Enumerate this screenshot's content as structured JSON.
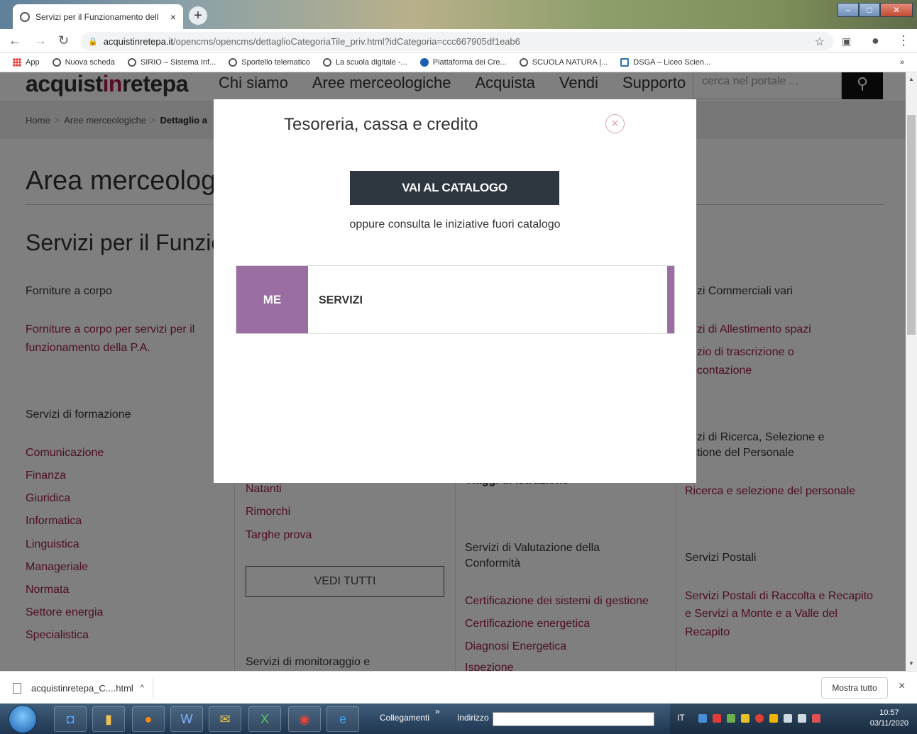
{
  "browser": {
    "tab_title": "Servizi per il Funzionamento dell",
    "tab_close": "×",
    "newtab": "+",
    "url_host": "acquistinretepa.it",
    "url_path": "/opencms/opencms/dettaglioCategoriaTile_priv.html?idCategoria=ccc667905df1eab6",
    "bookmarks": [
      "App",
      "Nuova scheda",
      "SIRIO – Sistema Inf...",
      "Sportello telematico",
      "La scuola digitale -...",
      "Piattaforma dei Cre...",
      "SCUOLA NATURA |...",
      "DSGA – Liceo Scien..."
    ],
    "bookmarks_more": "»"
  },
  "site": {
    "logo_a": "acquist",
    "logo_b": "in",
    "logo_c": "retepa",
    "nav": [
      "Chi siamo",
      "Aree merceologiche",
      "Acquista",
      "Vendi",
      "Supporto"
    ],
    "search_placeholder": "cerca nel portale ...",
    "breadcrumb": [
      "Home",
      "Aree merceologiche",
      "Dettaglio a"
    ],
    "h1": "Area merceolog",
    "h2": "Servizi per il Funzio"
  },
  "columns": {
    "c1": {
      "h_a": "Forniture a corpo",
      "l_a": [
        "Forniture a corpo per servizi per il",
        "funzionamento della P.A."
      ],
      "h_b": "Servizi di formazione",
      "l_b": [
        "Comunicazione",
        "Finanza",
        "Giuridica",
        "Informatica",
        "Linguistica",
        "Manageriale",
        "Normata",
        "Settore energia",
        "Specialistica"
      ]
    },
    "c2": {
      "l_a": [
        "Natanti",
        "Rimorchi",
        "Targhe prova"
      ],
      "vedi": "VEDI TUTTI",
      "h_b": "Servizi di monitoraggio e"
    },
    "c3": {
      "l_top": "Viaggi di istruzione",
      "h_a": [
        "Servizi di Valutazione della",
        "Conformità"
      ],
      "l_a": [
        "Certificazione dei sistemi di gestione",
        "Certificazione energetica",
        "Diagnosi Energetica",
        "Ispezione"
      ]
    },
    "c4": {
      "h_a": "rvizi Commerciali vari",
      "l_a": [
        "rvizi di Allestimento spazi",
        "rvizio di trascrizione o",
        "socontazione"
      ],
      "h_b": [
        "rvizi di Ricerca, Selezione e",
        "estione del Personale"
      ],
      "l_b": "Ricerca e selezione del personale",
      "h_c": "Servizi Postali",
      "l_c": [
        "Servizi Postali di Raccolta e Recapito",
        "e Servizi a Monte e a Valle del",
        "Recapito"
      ]
    }
  },
  "modal": {
    "title": "Tesoreria, cassa e credito",
    "close": "×",
    "button": "VAI AL CATALOGO",
    "oppure": "oppure consulta le iniziative fuori catalogo",
    "card_badge": "ME",
    "card_label": "SERVIZI",
    "accent_color": "#9a6ea2"
  },
  "downloads": {
    "file": "acquistinretepa_C....html",
    "chev": "^",
    "show_all": "Mostra tutto",
    "close": "×"
  },
  "taskbar": {
    "links": "Collegamenti",
    "links_more": "»",
    "address": "Indirizzo",
    "lang": "IT",
    "time": "10:57",
    "date": "03/11/2020"
  }
}
